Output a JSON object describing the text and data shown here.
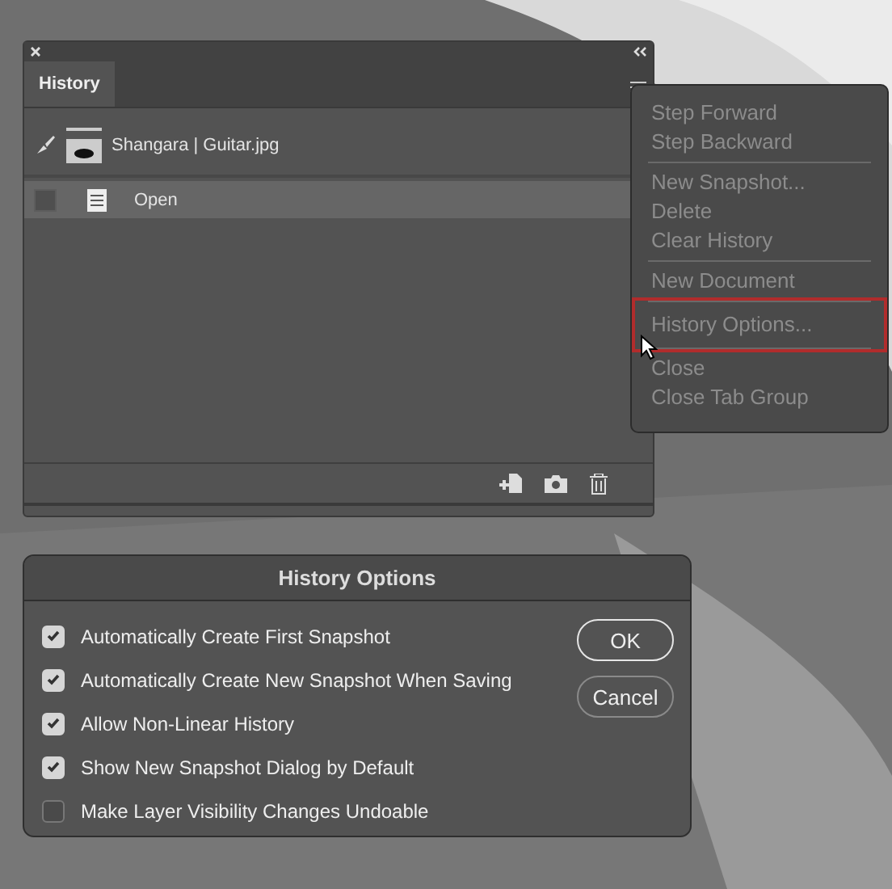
{
  "history_panel": {
    "tabs": [
      {
        "label": "History",
        "selected": true
      }
    ],
    "snapshot": {
      "name": "Shangara | Guitar.jpg"
    },
    "steps": [
      {
        "label": "Open",
        "selected": true
      }
    ]
  },
  "panel_menu": {
    "groups": [
      {
        "items": [
          {
            "label": "Step Forward",
            "disabled": true,
            "highlighted": false
          },
          {
            "label": "Step Backward",
            "disabled": true,
            "highlighted": false
          }
        ]
      },
      {
        "items": [
          {
            "label": "New Snapshot...",
            "disabled": true,
            "highlighted": false
          },
          {
            "label": "Delete",
            "disabled": true,
            "highlighted": false
          },
          {
            "label": "Clear History",
            "disabled": true,
            "highlighted": false
          }
        ]
      },
      {
        "items": [
          {
            "label": "New Document",
            "disabled": true,
            "highlighted": false
          }
        ]
      },
      {
        "items": [
          {
            "label": "History Options...",
            "disabled": true,
            "highlighted": true
          }
        ]
      },
      {
        "items": [
          {
            "label": "Close",
            "disabled": true,
            "highlighted": false
          },
          {
            "label": "Close Tab Group",
            "disabled": true,
            "highlighted": false
          }
        ]
      }
    ]
  },
  "dialog": {
    "title": "History Options",
    "options": [
      {
        "label": "Automatically Create First Snapshot",
        "checked": true
      },
      {
        "label": "Automatically Create New Snapshot When Saving",
        "checked": true
      },
      {
        "label": "Allow Non-Linear History",
        "checked": true
      },
      {
        "label": "Show New Snapshot Dialog by Default",
        "checked": true
      },
      {
        "label": "Make Layer Visibility Changes Undoable",
        "checked": false
      }
    ],
    "buttons": [
      {
        "label": "OK",
        "default": true
      },
      {
        "label": "Cancel",
        "default": false
      }
    ]
  }
}
